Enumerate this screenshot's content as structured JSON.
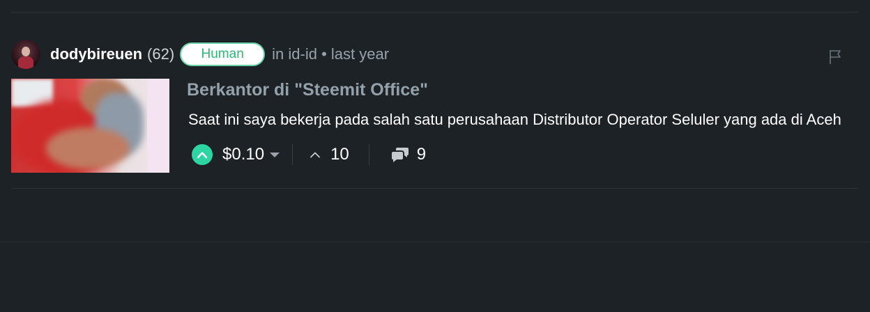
{
  "post": {
    "author": "dodybireuen",
    "reputation": "(62)",
    "badge": "Human",
    "meta": {
      "prefix": "in",
      "community": "id-id",
      "separator": "•",
      "time": "last year"
    },
    "title": "Berkantor di \"Steemit Office\"",
    "excerpt": "Saat ini saya bekerja pada salah satu perusahaan Distributor Operator Seluler yang ada di Aceh",
    "payout": "$0.10",
    "votes": "10",
    "comments": "9"
  },
  "icons": {
    "avatar": "author-avatar",
    "flag": "flag-icon",
    "upvote": "chevron-up-circle-icon",
    "payout_dropdown": "caret-down-icon",
    "votes": "chevron-up-icon",
    "comments": "chat-bubbles-icon"
  },
  "colors": {
    "background": "#1c2226",
    "upvote_accent": "#2dd5a2",
    "badge_text": "#2fb574",
    "title": "#94a1ab",
    "meta": "#9aa3aa"
  }
}
